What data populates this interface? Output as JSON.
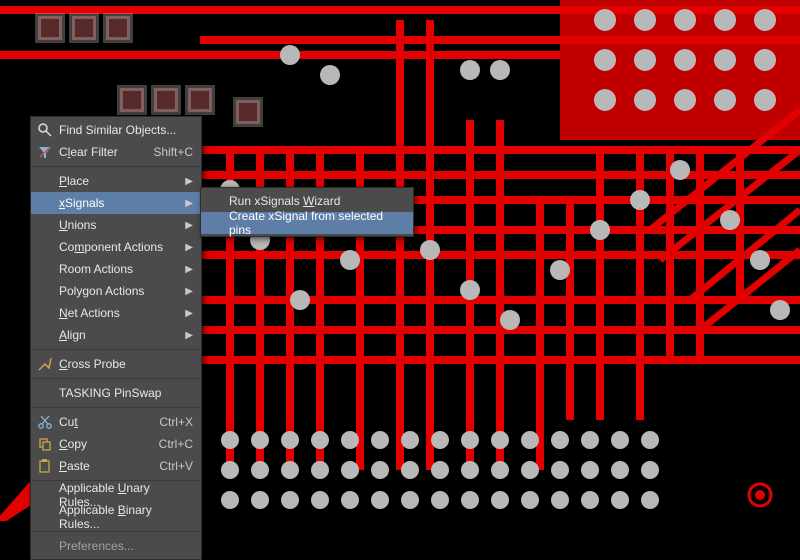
{
  "main_menu": {
    "find_similar": "Find Similar Objects...",
    "clear_filter": {
      "label": "Clear Filter",
      "shortcut": "Shift+C"
    },
    "place": "Place",
    "xsignals": "xSignals",
    "unions": "Unions",
    "component_actions": "Component Actions",
    "room_actions": "Room Actions",
    "polygon_actions": "Polygon Actions",
    "net_actions": "Net Actions",
    "align": "Align",
    "cross_probe": "Cross Probe",
    "tasking_pinswap": "TASKING PinSwap",
    "cut": {
      "label": "Cut",
      "shortcut": "Ctrl+X"
    },
    "copy": {
      "label": "Copy",
      "shortcut": "Ctrl+C"
    },
    "paste": {
      "label": "Paste",
      "shortcut": "Ctrl+V"
    },
    "applicable_unary": "Applicable Unary Rules...",
    "applicable_binary": "Applicable Binary Rules...",
    "preferences": "Preferences..."
  },
  "submenu_xsignals": {
    "run_wizard": "Run xSignals Wizard",
    "create_from_pins": "Create xSignal from selected pins"
  }
}
